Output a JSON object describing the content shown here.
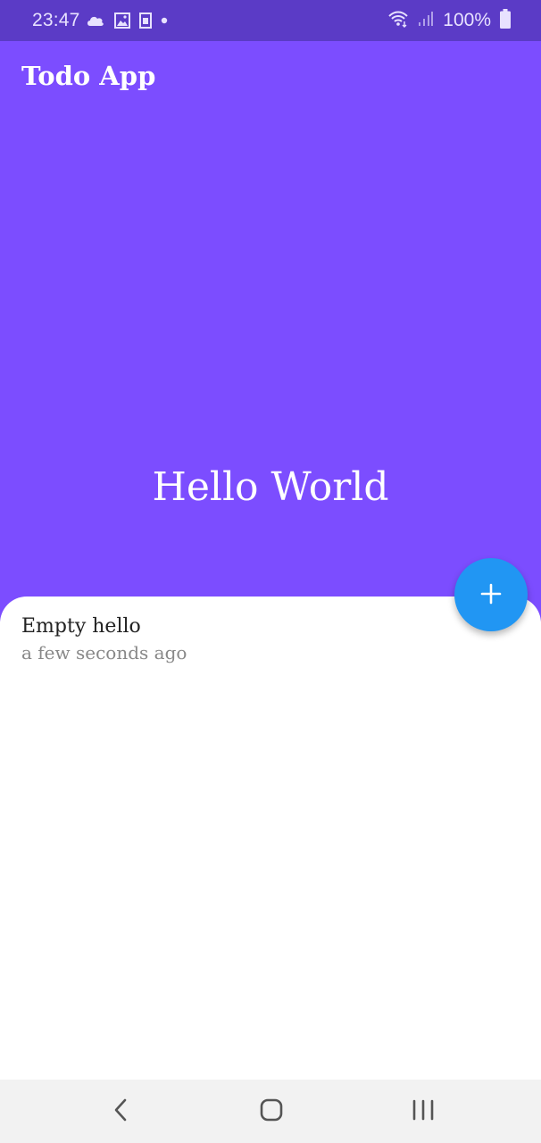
{
  "status_bar": {
    "time": "23:47",
    "battery": "100%",
    "icons": [
      "cloud-icon",
      "image-icon",
      "sim-card-icon",
      "dot-icon",
      "wifi-icon",
      "signal-icon",
      "battery-icon"
    ],
    "background": "#5b3bc6"
  },
  "header": {
    "title": "Todo App",
    "hero_text": "Hello World",
    "background": "#7c4dff"
  },
  "todos": [
    {
      "title": "Empty hello",
      "time": "a few seconds ago"
    }
  ],
  "fab": {
    "icon": "plus-icon",
    "color": "#2196f3"
  },
  "nav_bar": {
    "icons": [
      "back-icon",
      "home-icon",
      "recents-icon"
    ]
  }
}
